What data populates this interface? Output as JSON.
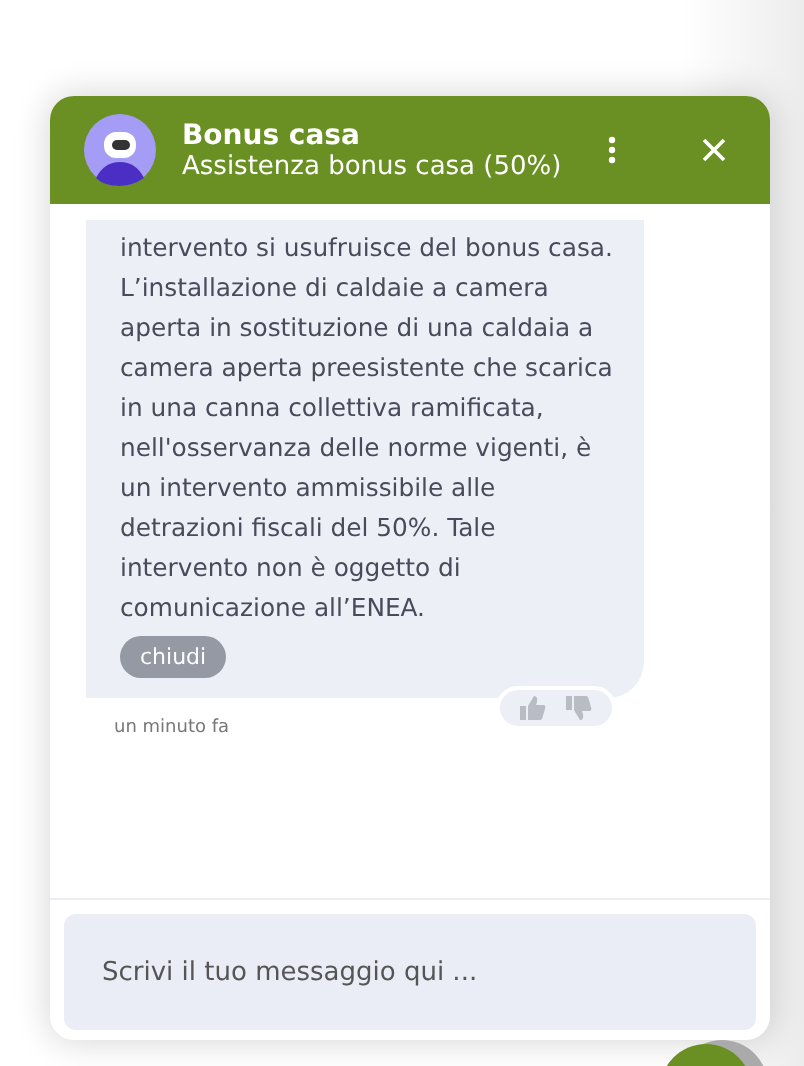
{
  "header": {
    "title": "Bonus casa",
    "subtitle": "Assistenza bonus casa (50%)"
  },
  "message": {
    "paragraphs": [
      "intervento si usufruisce del bonus casa.",
      "L’installazione di caldaie a camera aperta in sostituzione di una caldaia a camera aperta preesistente che scarica in una canna collettiva ramificata, nell'osservanza delle norme vigenti, è un intervento ammissibile alle detrazioni fiscali del 50%. Tale intervento non è oggetto di comunicazione all’ENEA."
    ],
    "action": "chiudi",
    "time": "un minuto fa"
  },
  "composer": {
    "placeholder": "Scrivi il tuo messaggio qui ..."
  }
}
